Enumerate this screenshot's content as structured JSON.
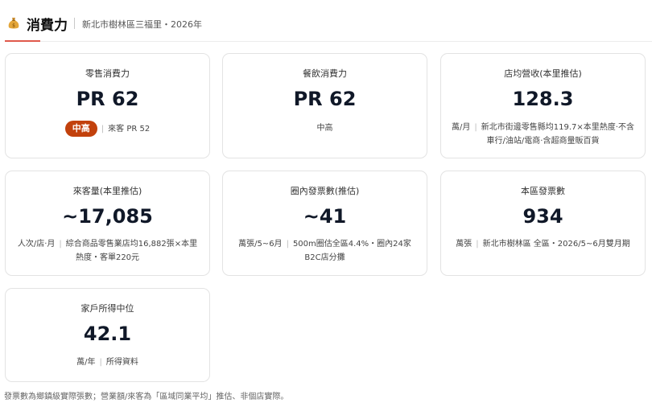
{
  "header": {
    "title": "消費力",
    "subtitle": "新北市樹林區三福里・2026年",
    "icon": "moneybag-icon"
  },
  "cards": [
    {
      "label": "零售消費力",
      "value": "PR 62",
      "badge": "中高",
      "note": "來客 PR 52"
    },
    {
      "label": "餐飲消費力",
      "value": "PR 62",
      "note": "中高"
    },
    {
      "label": "店均營收(本里推估)",
      "value": "128.3",
      "unit": "萬/月",
      "note": "新北市街邊零售縣均119.7×本里熱度·不含車行/油站/電商·含超商量販百貨"
    },
    {
      "label": "來客量(本里推估)",
      "value": "~17,085",
      "unit": "人次/店·月",
      "note": "綜合商品零售業店均16,882張×本里熱度・客單220元"
    },
    {
      "label": "圈內發票數(推估)",
      "value": "~41",
      "unit": "萬張/5~6月",
      "note": "500m圈估全區4.4%・圈內24家B2C店分攤"
    },
    {
      "label": "本區發票數",
      "value": "934",
      "unit": "萬張",
      "note": "新北市樹林區 全區・2026/5~6月雙月期"
    },
    {
      "label": "家戶所得中位",
      "value": "42.1",
      "unit": "萬/年",
      "note": "所得資料"
    }
  ],
  "footer": "發票數為鄉鎮級實際張數；營業額/來客為「區域同業平均」推估、非個店實際。",
  "colors": {
    "accent": "#e0594b",
    "badge": "#c2410c",
    "border": "#e3e3e3"
  }
}
